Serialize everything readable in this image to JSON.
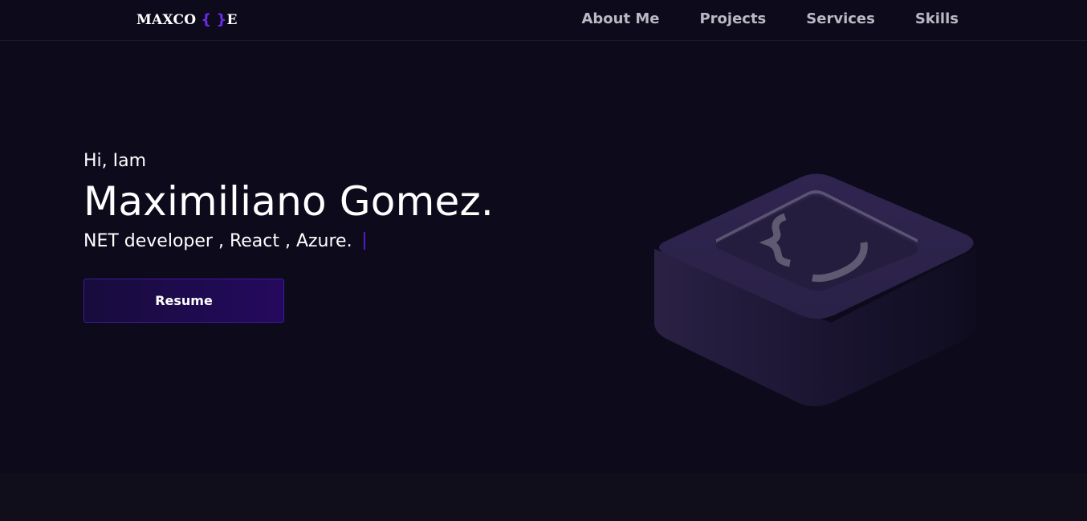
{
  "brand": {
    "logo_pre": "MAXCO",
    "logo_brace_open": "{",
    "logo_brace_close": "}",
    "logo_post": "E"
  },
  "nav": {
    "items": [
      {
        "label": "About Me"
      },
      {
        "label": "Projects"
      },
      {
        "label": "Services"
      },
      {
        "label": "Skills"
      }
    ]
  },
  "hero": {
    "greeting": "Hi, Iam",
    "name": "Maximiliano Gomez.",
    "roles": "NET developer , React , Azure.",
    "resume_label": "Resume",
    "illustration_icon": "curly-braces-block-icon"
  },
  "colors": {
    "background": "#0d0b1b",
    "accent": "#6a2be8",
    "button_gradient_start": "#170c3c",
    "button_gradient_end": "#25095e",
    "nav_text": "#b9b8c3"
  }
}
